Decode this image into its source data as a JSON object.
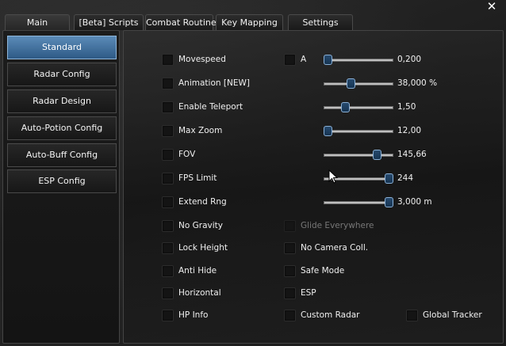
{
  "window": {
    "close_label": "✕"
  },
  "tabs": [
    {
      "label": "Main",
      "active": true
    },
    {
      "label": "[Beta] Scripts"
    },
    {
      "label": "Combat Routine"
    },
    {
      "label": "Key Mapping"
    },
    {
      "label": "Settings"
    }
  ],
  "sidebar": {
    "items": [
      {
        "label": "Standard",
        "active": true
      },
      {
        "label": "Radar Config"
      },
      {
        "label": "Radar Design"
      },
      {
        "label": "Auto-Potion Config"
      },
      {
        "label": "Auto-Buff Config"
      },
      {
        "label": "ESP Config"
      }
    ]
  },
  "settings": {
    "movespeed": {
      "label": "Movespeed",
      "extra_label": "A",
      "value": "0,200",
      "level": 0.0
    },
    "animation": {
      "label": "Animation [NEW]",
      "value": "38,000 %",
      "level": 0.38
    },
    "teleport": {
      "label": "Enable Teleport",
      "value": "1,50",
      "level": 0.28
    },
    "maxzoom": {
      "label": "Max Zoom",
      "value": "12,00",
      "level": 0.0
    },
    "fov": {
      "label": "FOV",
      "value": "145,66",
      "level": 0.8
    },
    "fps": {
      "label": "FPS Limit",
      "value": "244",
      "level": 1.0
    },
    "extend": {
      "label": "Extend Rng",
      "value": "3,000 m",
      "level": 1.0
    },
    "nogravity": {
      "label": "No Gravity"
    },
    "glide": {
      "label": "Glide Everywhere",
      "disabled": true
    },
    "lockheight": {
      "label": "Lock Height"
    },
    "nocamcoll": {
      "label": "No Camera Coll."
    },
    "antihide": {
      "label": "Anti Hide"
    },
    "safemode": {
      "label": "Safe Mode"
    },
    "horizontal": {
      "label": "Horizontal"
    },
    "esp": {
      "label": "ESP"
    },
    "hpinfo": {
      "label": "HP Info"
    },
    "customradar": {
      "label": "Custom Radar"
    },
    "globaltracker": {
      "label": "Global Tracker"
    }
  }
}
